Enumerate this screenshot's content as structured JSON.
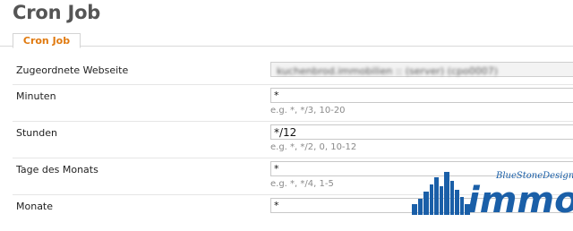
{
  "page": {
    "title": "Cron Job"
  },
  "tabs": [
    {
      "label": "Cron Job"
    }
  ],
  "rows": [
    {
      "label": "Zugeordnete Webseite",
      "value": "kuchenbrod.immobilien :: (server) (cpo0007)",
      "hint": ""
    },
    {
      "label": "Minuten",
      "value": "*",
      "hint": "e.g. *, */3, 10-20"
    },
    {
      "label": "Stunden",
      "value": "*/12",
      "hint": "e.g. *, */2, 0, 10-12"
    },
    {
      "label": "Tage des Monats",
      "value": "*",
      "hint": "e.g. *, */4, 1-5"
    },
    {
      "label": "Monate",
      "value": "*",
      "hint": ""
    }
  ],
  "logo": {
    "tagline": "BlueStoneDesign",
    "wordmark": "immo",
    "color": "#1a5fa8"
  }
}
